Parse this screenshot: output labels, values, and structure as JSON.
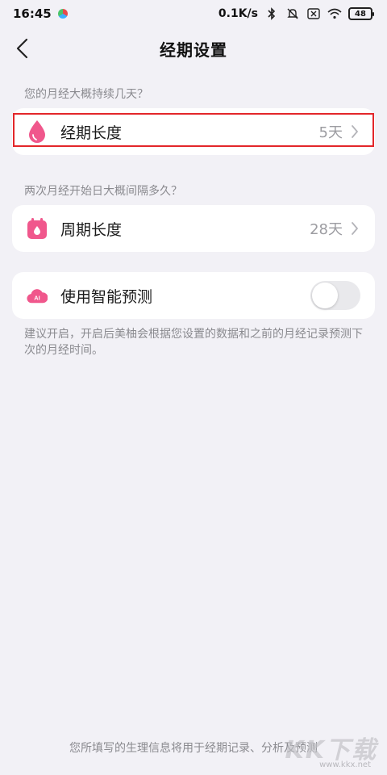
{
  "status_bar": {
    "time": "16:45",
    "network_speed": "0.1K/s",
    "battery": "48",
    "icons": [
      "bluetooth-icon",
      "mute-icon",
      "sim-off-icon",
      "wifi-icon",
      "battery-icon"
    ]
  },
  "header": {
    "title": "经期设置"
  },
  "period_section": {
    "hint": "您的月经大概持续几天？",
    "label": "经期长度",
    "value": "5天",
    "icon": "drop-icon",
    "icon_color": "#f0578c"
  },
  "cycle_section": {
    "hint": "两次月经开始日大概间隔多久？",
    "label": "周期长度",
    "value": "28天",
    "icon": "calendar-icon",
    "icon_color": "#f0578c"
  },
  "prediction": {
    "label": "使用智能预测",
    "icon": "ai-cloud-icon",
    "icon_text": "AI",
    "enabled": false
  },
  "note": "建议开启，开启后美柚会根据您设置的数据和之前的月经记录预测下次的月经时间。",
  "footer": "您所填写的生理信息将用于经期记录、分析及预测",
  "watermark": {
    "text": "KK下载",
    "url": "www.kkx.net"
  },
  "colors": {
    "background": "#f2f1f6",
    "accent": "#f0578c",
    "highlight": "#e3262a"
  }
}
